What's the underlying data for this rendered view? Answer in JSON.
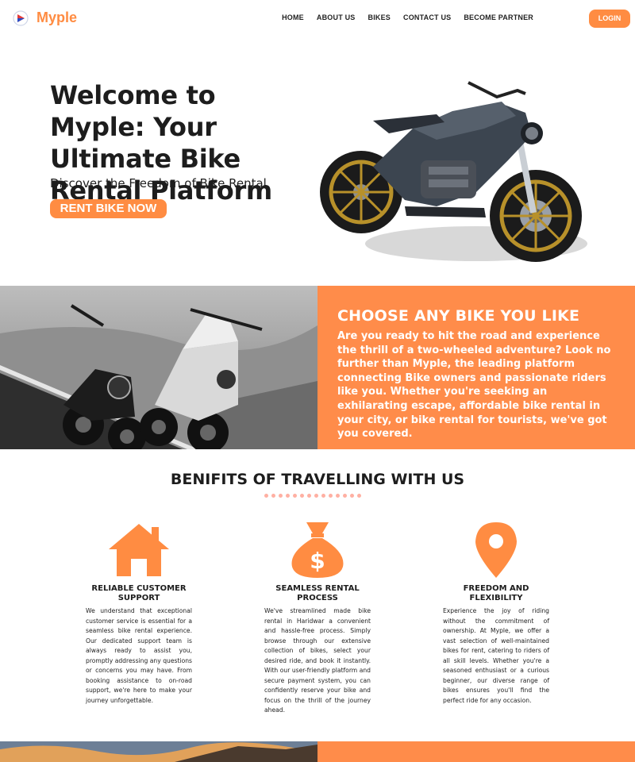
{
  "brand": {
    "name": "Myple",
    "accent": "#ff8c42"
  },
  "nav": {
    "links": [
      "HOME",
      "ABOUT US",
      "BIKES",
      "CONTACT US",
      "BECOME PARTNER"
    ],
    "login": "LOGIN"
  },
  "hero": {
    "title": "Welcome to Myple: Your Ultimate Bike Rental Platform",
    "subtitle": "Discover the Freedom of Bike Rental",
    "cta": "RENT BIKE NOW"
  },
  "choose": {
    "title": "CHOOSE ANY BIKE YOU LIKE",
    "text": "Are you ready to hit the road and experience the thrill of a two-wheeled adventure? Look no further than Myple, the leading platform connecting Bike owners and passionate riders like you. Whether you're seeking an exhilarating escape, affordable bike rental in your city, or bike rental for tourists, we've got you covered."
  },
  "benefits": {
    "title": "BENIFITS OF TRAVELLING WITH US",
    "items": [
      {
        "icon": "house-icon",
        "heading": "RELIABLE CUSTOMER SUPPORT",
        "text": "We understand that exceptional customer service is essential for a seamless bike rental experience. Our dedicated support team is always ready to assist you, promptly addressing any questions or concerns you may have. From booking assistance to on-road support, we're here to make your journey unforgettable."
      },
      {
        "icon": "money-bag-icon",
        "heading": "SEAMLESS RENTAL PROCESS",
        "text": "We've streamlined made bike rental in Haridwar a convenient and hassle-free process. Simply browse through our extensive collection of bikes, select your desired ride, and book it instantly. With our user-friendly platform and secure payment system, you can confidently reserve your bike and focus on the thrill of the journey ahead."
      },
      {
        "icon": "location-pin-icon",
        "heading": "FREEDOM AND FLEXIBILITY",
        "text": "Experience the joy of riding without the commitment of ownership. At Myple, we offer a vast selection of well-maintained bikes for rent, catering to riders of all skill levels. Whether you're a seasoned enthusiast or a curious beginner, our diverse range of bikes ensures you'll find the perfect ride for any occasion."
      }
    ]
  }
}
